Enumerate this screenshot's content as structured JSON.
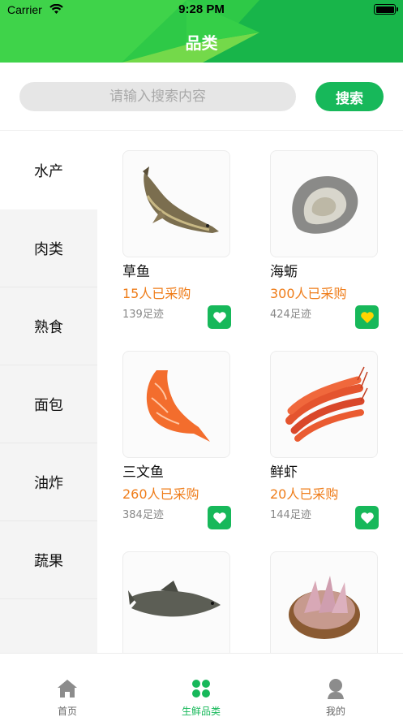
{
  "status_bar": {
    "carrier": "Carrier",
    "time": "9:28 PM"
  },
  "header": {
    "title": "品类"
  },
  "search": {
    "placeholder": "请输入搜索内容",
    "button_label": "搜索"
  },
  "sidebar": {
    "items": [
      {
        "label": "水产",
        "active": true
      },
      {
        "label": "肉类",
        "active": false
      },
      {
        "label": "熟食",
        "active": false
      },
      {
        "label": "面包",
        "active": false
      },
      {
        "label": "油炸",
        "active": false
      },
      {
        "label": "蔬果",
        "active": false
      }
    ]
  },
  "products": [
    {
      "name": "草鱼",
      "bought": "15人已采购",
      "views": "139足迹",
      "image": "grass-carp-image",
      "favorited": false
    },
    {
      "name": "海蛎",
      "bought": "300人已采购",
      "views": "424足迹",
      "image": "oyster-image",
      "favorited": true
    },
    {
      "name": "三文鱼",
      "bought": "260人已采购",
      "views": "384足迹",
      "image": "salmon-image",
      "favorited": false
    },
    {
      "name": "鲜虾",
      "bought": "20人已采购",
      "views": "144足迹",
      "image": "shrimp-image",
      "favorited": false
    },
    {
      "name": "",
      "bought": "",
      "views": "",
      "image": "fish-image",
      "favorited": false
    },
    {
      "name": "",
      "bought": "",
      "views": "",
      "image": "squid-image",
      "favorited": false
    }
  ],
  "tabbar": {
    "tabs": [
      {
        "label": "首页",
        "icon": "home-icon",
        "active": false
      },
      {
        "label": "生鲜品类",
        "icon": "grid-icon",
        "active": true
      },
      {
        "label": "我的",
        "icon": "user-icon",
        "active": false
      }
    ]
  },
  "colors": {
    "brand_green": "#17b85a",
    "header_green": "#3fd34a",
    "accent_orange": "#ef7d1a",
    "heart_active": "#ffd400"
  }
}
